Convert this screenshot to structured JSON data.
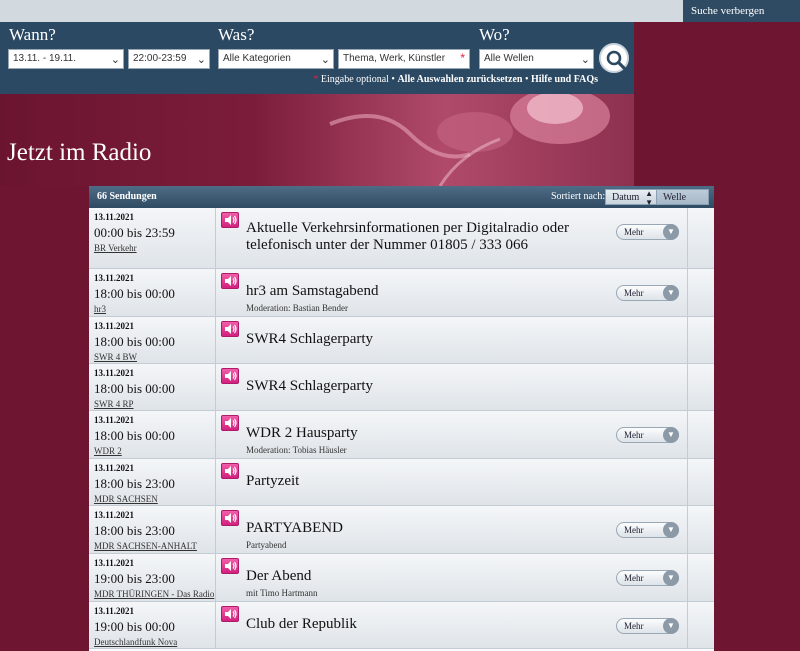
{
  "topbar": {
    "hide_search": "Suche verbergen"
  },
  "search": {
    "when_label": "Wann?",
    "what_label": "Was?",
    "where_label": "Wo?",
    "date_range": "13.11. - 19.11.",
    "time_range": "22:00-23:59",
    "category": "Alle Kategorien",
    "topic_placeholder": "Thema, Werk, Künstler",
    "station": "Alle Wellen",
    "hint_required_mark": "*",
    "hint_optional": "Eingabe optional",
    "hint_reset": "Alle Auswahlen zurücksetzen",
    "hint_help": "Hilfe und FAQs",
    "bullet": "•"
  },
  "hero": {
    "title": "Jetzt im Radio"
  },
  "list": {
    "count": "66 Sendungen",
    "sort_label": "Sortiert nach:",
    "sort_date": "Datum",
    "sort_station": "Welle",
    "more_label": "Mehr",
    "rows": [
      {
        "date": "13.11.2021",
        "time": "00:00 bis 23:59",
        "station": "BR Verkehr",
        "title": "Aktuelle Verkehrsinformationen per Digitalradio oder telefonisch unter der Nummer 01805 / 333 066",
        "sub": "",
        "more": true
      },
      {
        "date": "13.11.2021",
        "time": "18:00 bis 00:00",
        "station": "hr3",
        "title": "hr3 am Samstagabend",
        "sub": "Moderation: Bastian Bender",
        "more": true
      },
      {
        "date": "13.11.2021",
        "time": "18:00 bis 00:00",
        "station": "SWR 4 BW",
        "title": "SWR4 Schlagerparty",
        "sub": "",
        "more": false
      },
      {
        "date": "13.11.2021",
        "time": "18:00 bis 00:00",
        "station": "SWR 4 RP",
        "title": "SWR4 Schlagerparty",
        "sub": "",
        "more": false
      },
      {
        "date": "13.11.2021",
        "time": "18:00 bis 00:00",
        "station": "WDR 2",
        "title": "WDR 2 Hausparty",
        "sub": "Moderation: Tobias Häusler",
        "more": true
      },
      {
        "date": "13.11.2021",
        "time": "18:00 bis 23:00",
        "station": "MDR SACHSEN",
        "title": "Partyzeit",
        "sub": "",
        "more": false
      },
      {
        "date": "13.11.2021",
        "time": "18:00 bis 23:00",
        "station": "MDR SACHSEN-ANHALT",
        "title": "PARTYABEND",
        "sub": "Partyabend",
        "more": true
      },
      {
        "date": "13.11.2021",
        "time": "19:00 bis 23:00",
        "station": "MDR THÜRINGEN - Das Radio",
        "title": "Der Abend",
        "sub": "mit Timo Hartmann",
        "more": true
      },
      {
        "date": "13.11.2021",
        "time": "19:00 bis 00:00",
        "station": "Deutschlandfunk Nova",
        "title": "Club der Republik",
        "sub": "",
        "more": true
      }
    ]
  }
}
